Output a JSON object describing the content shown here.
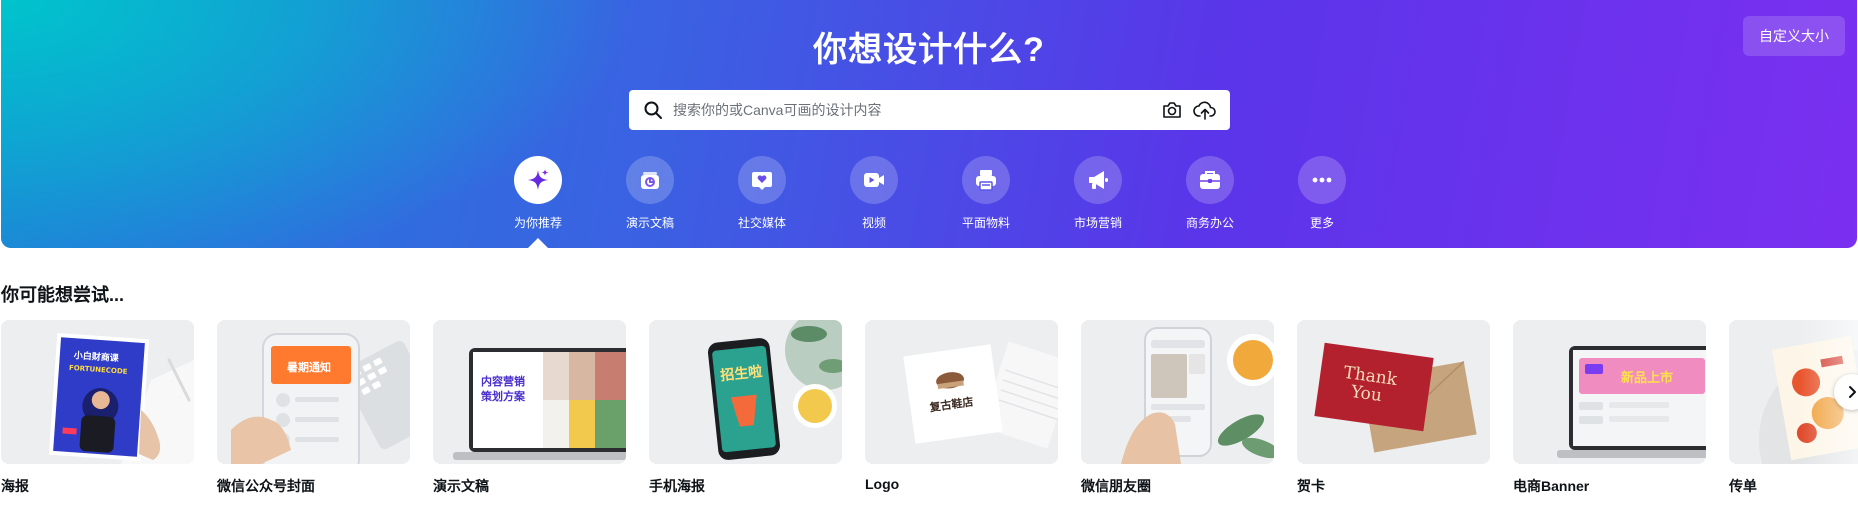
{
  "hero": {
    "title": "你想设计什么?",
    "custom_size_label": "自定义大小",
    "gradient_colors": [
      "#00c4cc",
      "#3a62e2",
      "#7b2ff0"
    ]
  },
  "search": {
    "placeholder": "搜索你的或Canva可画的设计内容",
    "value": ""
  },
  "categories": [
    {
      "label": "为你推荐",
      "icon": "sparkle-icon",
      "active": true
    },
    {
      "label": "演示文稿",
      "icon": "presentation-icon",
      "active": false
    },
    {
      "label": "社交媒体",
      "icon": "heart-chat-icon",
      "active": false
    },
    {
      "label": "视频",
      "icon": "video-camera-icon",
      "active": false
    },
    {
      "label": "平面物料",
      "icon": "printer-icon",
      "active": false
    },
    {
      "label": "市场营销",
      "icon": "megaphone-icon",
      "active": false
    },
    {
      "label": "商务办公",
      "icon": "briefcase-icon",
      "active": false
    },
    {
      "label": "更多",
      "icon": "more-icon",
      "active": false
    }
  ],
  "suggestions": {
    "title": "你可能想尝试...",
    "items": [
      {
        "label": "海报",
        "thumb_text": [
          "小白财商课",
          "FORTUNECODE"
        ]
      },
      {
        "label": "微信公众号封面",
        "thumb_text": [
          "暑期通知"
        ]
      },
      {
        "label": "演示文稿",
        "thumb_text": [
          "内容营销",
          "策划方案"
        ]
      },
      {
        "label": "手机海报",
        "thumb_text": [
          "招生啦"
        ]
      },
      {
        "label": "Logo",
        "thumb_text": [
          "复古鞋店"
        ]
      },
      {
        "label": "微信朋友圈",
        "thumb_text": []
      },
      {
        "label": "贺卡",
        "thumb_text": [
          "Thank",
          "You"
        ]
      },
      {
        "label": "电商Banner",
        "thumb_text": [
          "新品上市"
        ]
      },
      {
        "label": "传单",
        "thumb_text": []
      }
    ]
  },
  "colors": {
    "accent": "#7d2ae8",
    "text": "#0e1318"
  }
}
